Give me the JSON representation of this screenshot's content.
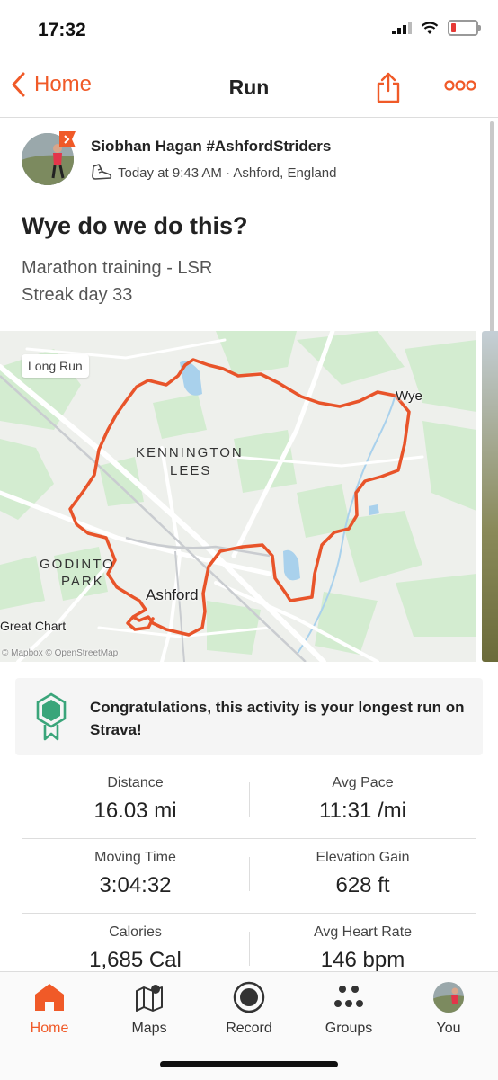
{
  "status_bar": {
    "time": "17:32"
  },
  "nav": {
    "back_label": "Home",
    "title": "Run"
  },
  "activity": {
    "athlete_name": "Siobhan Hagan #AshfordStriders",
    "meta": "Today at 9:43 AM · Ashford, England",
    "title": "Wye do we do this?",
    "description_lines": [
      "Marathon training - LSR",
      "Streak day 33"
    ]
  },
  "map": {
    "tag": "Long Run",
    "labels": {
      "kennington": "KENNINGTON",
      "lees": "LEES",
      "godinton": "GODINTON",
      "park": "PARK",
      "ashford": "Ashford",
      "wye": "Wye",
      "great_chart": "Great Chart",
      "attribution": "© Mapbox © OpenStreetMap"
    },
    "route_color": "#e8542a"
  },
  "achievement": {
    "text": "Congratulations, this activity is your longest run on Strava!"
  },
  "stats": [
    {
      "label": "Distance",
      "value": "16.03 mi"
    },
    {
      "label": "Avg Pace",
      "value": "11:31 /mi"
    },
    {
      "label": "Moving Time",
      "value": "3:04:32"
    },
    {
      "label": "Elevation Gain",
      "value": "628 ft"
    },
    {
      "label": "Calories",
      "value": "1,685 Cal"
    },
    {
      "label": "Avg Heart Rate",
      "value": "146 bpm"
    }
  ],
  "tabs": [
    {
      "label": "Home",
      "icon": "home-icon",
      "active": true
    },
    {
      "label": "Maps",
      "icon": "maps-icon",
      "active": false
    },
    {
      "label": "Record",
      "icon": "record-icon",
      "active": false
    },
    {
      "label": "Groups",
      "icon": "groups-icon",
      "active": false
    },
    {
      "label": "You",
      "icon": "avatar",
      "active": false
    }
  ],
  "colors": {
    "accent": "#f05a28",
    "achievement_green": "#3aa57a"
  }
}
